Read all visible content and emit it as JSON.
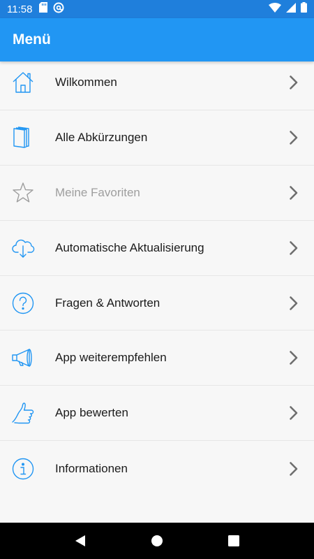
{
  "status_bar": {
    "time": "11:58"
  },
  "app_bar": {
    "title": "Menü"
  },
  "menu": {
    "items": [
      {
        "label": "Wilkommen",
        "icon": "house-icon",
        "enabled": true
      },
      {
        "label": "Alle Abkürzungen",
        "icon": "book-icon",
        "enabled": true
      },
      {
        "label": "Meine Favoriten",
        "icon": "star-icon",
        "enabled": false
      },
      {
        "label": "Automatische Aktualisierung",
        "icon": "cloud-download-icon",
        "enabled": true
      },
      {
        "label": "Fragen & Antworten",
        "icon": "question-icon",
        "enabled": true
      },
      {
        "label": "App weiterempfehlen",
        "icon": "megaphone-icon",
        "enabled": true
      },
      {
        "label": "App bewerten",
        "icon": "thumbs-up-icon",
        "enabled": true
      },
      {
        "label": "Informationen",
        "icon": "info-icon",
        "enabled": true
      }
    ]
  },
  "colors": {
    "status_bar": "#1f7fdc",
    "app_bar": "#2196f3",
    "icon_blue": "#2196f3",
    "disabled": "#9e9e9e"
  }
}
